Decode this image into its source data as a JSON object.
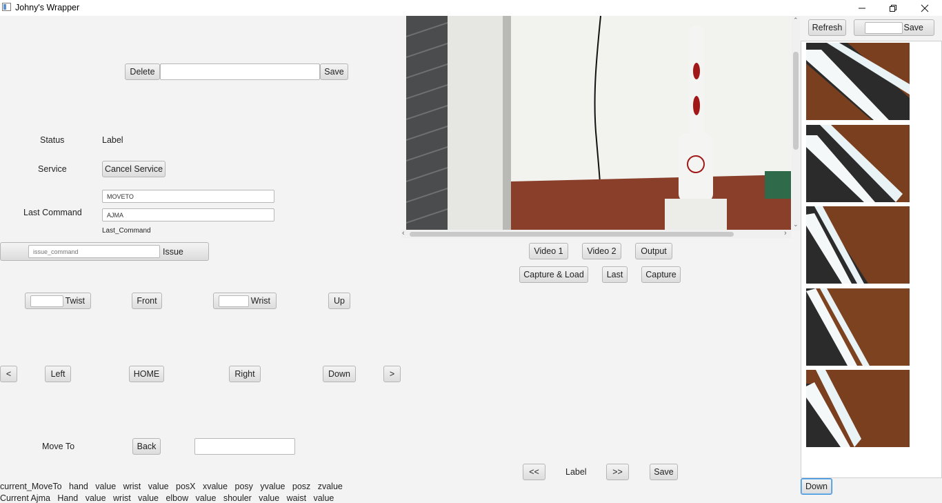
{
  "window": {
    "title": "Johny's Wrapper"
  },
  "top_controls": {
    "delete_label": "Delete",
    "name_value": "",
    "save_label": "Save"
  },
  "status": {
    "label": "Status",
    "value": "Label"
  },
  "service": {
    "label": "Service",
    "cancel_label": "Cancel Service"
  },
  "last_command": {
    "label": "Last Command",
    "command_value": "MOVETO",
    "source_value": "AJMA",
    "caption": "Last_Command"
  },
  "issue": {
    "placeholder": "issue_command",
    "button_label": "Issue"
  },
  "joint_controls": {
    "twist_label": "Twist",
    "front_label": "Front",
    "wrist_label": "Wrist",
    "up_label": "Up",
    "prev_label": "<",
    "left_label": "Left",
    "home_label": "HOME",
    "right_label": "Right",
    "down_label": "Down",
    "next_label": ">"
  },
  "move_to": {
    "label": "Move To",
    "back_label": "Back",
    "value": ""
  },
  "readouts": {
    "current_moveto": [
      "current_MoveTo",
      "hand",
      "value",
      "wrist",
      "value",
      "posX",
      "xvalue",
      "posy",
      "yvalue",
      "posz",
      "zvalue"
    ],
    "current_ajma": [
      "Current Ajma",
      "Hand",
      "value",
      "wrist",
      "value",
      "elbow",
      "value",
      "shouler",
      "value",
      "waist",
      "value"
    ]
  },
  "video_controls": {
    "video1_label": "Video 1",
    "video2_label": "Video 2",
    "output_label": "Output",
    "capture_load_label": "Capture & Load",
    "last_label": "Last",
    "capture_label": "Capture"
  },
  "pager": {
    "prev_label": "<<",
    "label": "Label",
    "next_label": ">>",
    "save_label": "Save"
  },
  "gallery": {
    "refresh_label": "Refresh",
    "name_value": "",
    "save_label": "Save",
    "down_label": "Down",
    "thumb_count": 5
  },
  "colors": {
    "background": "#f3f3f3",
    "focus": "#3b8fd8",
    "wood": "#7a3f1e"
  }
}
